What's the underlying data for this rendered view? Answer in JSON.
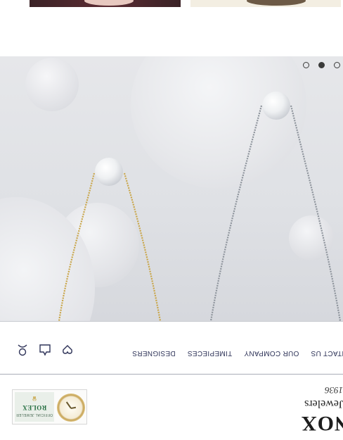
{
  "navigation": {
    "items": [
      {
        "label": "DESIGNERS"
      },
      {
        "label": "TIMEPIECES"
      },
      {
        "label": "OUR COMPANY"
      },
      {
        "label": "CONTACT US"
      }
    ],
    "icons": [
      "account-icon",
      "shopping-bag-icon",
      "wishlist-heart-icon"
    ]
  },
  "carousel": {
    "slide_count": 3,
    "active_index": 1
  },
  "brand": {
    "name": "NOX",
    "tagline": "Jewelers",
    "established": "1936"
  },
  "rolex_badge": {
    "brand": "ROLEX",
    "subtitle": "OFFICIAL JEWELER"
  },
  "colors": {
    "nav_text": "#2e3358",
    "hero_bg": "#e2e3e7",
    "rolex_green": "#1f6b3c",
    "gold_chain": "#c9a64a",
    "silver_chain": "#8e949c"
  }
}
